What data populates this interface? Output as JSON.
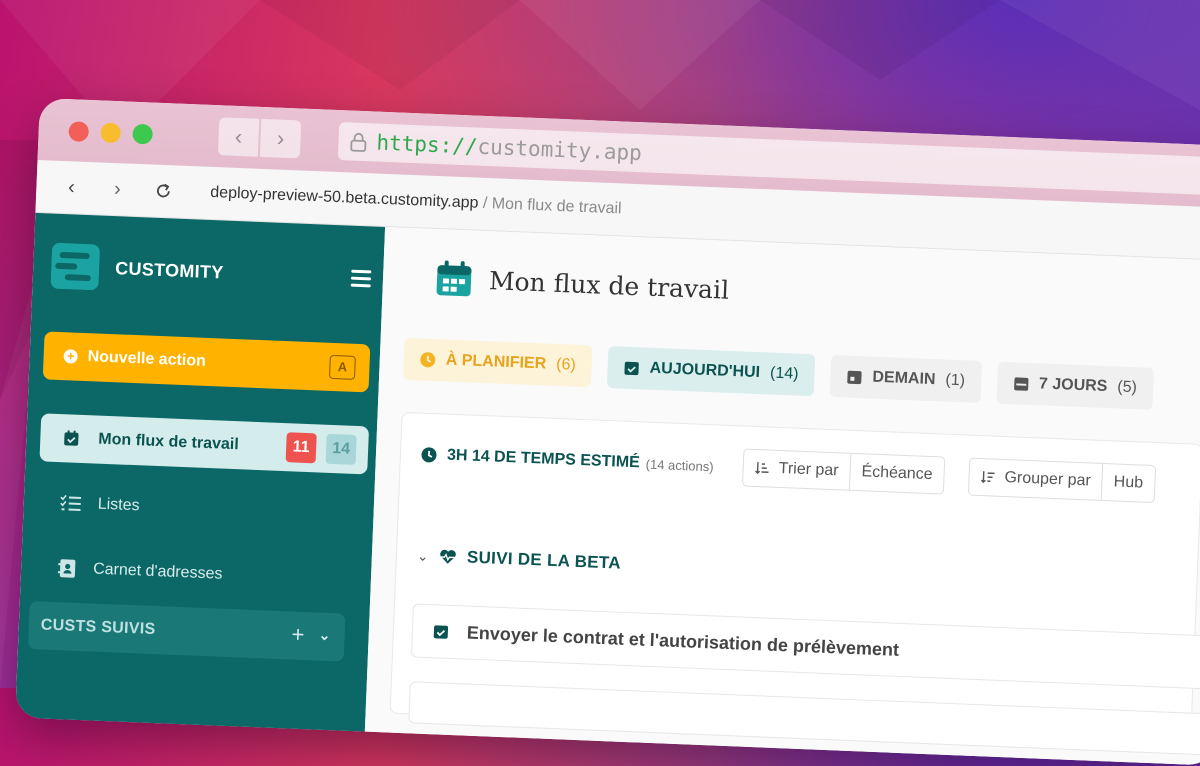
{
  "browser": {
    "url_scheme": "https://",
    "url_host": "customity.app",
    "breadcrumb_host": "deploy-preview-50.beta.customity.app",
    "breadcrumb_sep": "/",
    "breadcrumb_page": "Mon flux de travail"
  },
  "sidebar": {
    "brand": "CUSTOMITY",
    "new_action": {
      "label": "Nouvelle action",
      "shortcut": "A"
    },
    "active_item": {
      "label": "Mon flux de travail",
      "badge_red": "11",
      "badge_teal": "14"
    },
    "items": [
      {
        "label": "Listes",
        "icon": "checklist-icon"
      },
      {
        "label": "Carnet d'adresses",
        "icon": "address-book-icon"
      }
    ],
    "section": {
      "label": "CUSTS SUIVIS",
      "add": "+",
      "chevron": "⌄"
    }
  },
  "main": {
    "title": "Mon flux de travail",
    "tabs": [
      {
        "label": "À PLANIFIER",
        "count": "(6)"
      },
      {
        "label": "AUJOURD'HUI",
        "count": "(14)"
      },
      {
        "label": "DEMAIN",
        "count": "(1)"
      },
      {
        "label": "7 JOURS",
        "count": "(5)"
      }
    ],
    "estimate": {
      "label": "3H 14 DE TEMPS ESTIMÉ",
      "sub": "(14 actions)"
    },
    "sort": {
      "label": "Trier par",
      "value": "Échéance"
    },
    "group": {
      "label": "Grouper par",
      "value": "Hub"
    },
    "group_title": "SUIVI DE LA BETA",
    "tasks": [
      {
        "label": "Envoyer le contrat et l'autorisation de prélèvement"
      }
    ]
  },
  "colors": {
    "sidebar": "#0b6866",
    "accent_yellow": "#ffb200",
    "badge_red": "#ef5350",
    "teal_text": "#0b5351"
  }
}
